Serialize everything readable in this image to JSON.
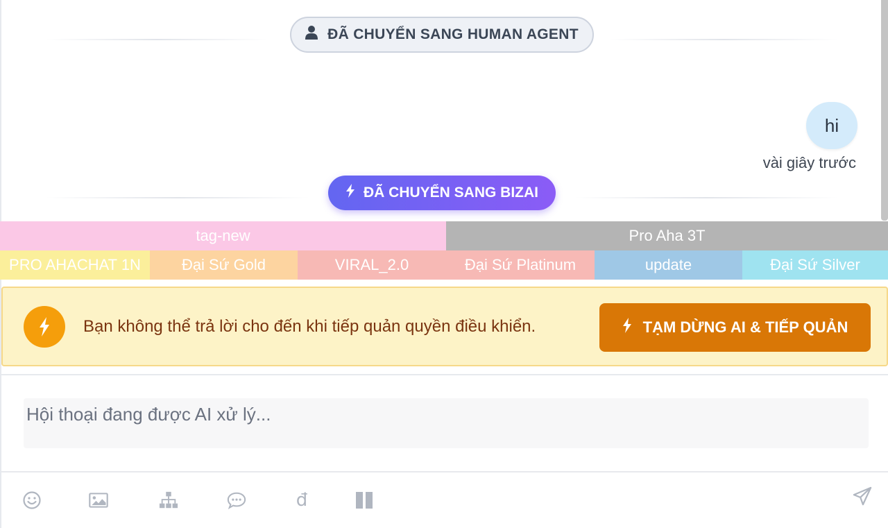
{
  "chat": {
    "status_human": "ĐÃ CHUYỂN SANG HUMAN AGENT",
    "message_text": "hi",
    "message_time": "vài giây trước",
    "status_bizai": "ĐÃ CHUYỂN SANG BIZAI"
  },
  "tags": {
    "row1": [
      {
        "label": "tag-new",
        "color": "#fbc8e6"
      },
      {
        "label": "Pro Aha 3T",
        "color": "#b4b4b4"
      }
    ],
    "row2": [
      {
        "label": "PRO AHACHAT 1N",
        "color": "#fbef9b"
      },
      {
        "label": "Đại Sứ Gold",
        "color": "#fdd4a0"
      },
      {
        "label": "VIRAL_2.0",
        "color": "#f7b9b5"
      },
      {
        "label": "Đại Sứ Platinum",
        "color": "#f7b9b5"
      },
      {
        "label": "update",
        "color": "#9fc8e6"
      },
      {
        "label": "Đại Sứ Silver",
        "color": "#9fe3f0"
      }
    ]
  },
  "warning": {
    "text": "Bạn không thể trả lời cho đến khi tiếp quản quyền điều khiển.",
    "button_label": "TẠM DỪNG AI & TIẾP QUẢN"
  },
  "composer": {
    "placeholder": "Hội thoại đang được AI xử lý...",
    "currency_symbol": "đ"
  },
  "toolbar_icons": [
    "emoji-icon",
    "image-icon",
    "sitemap-icon",
    "chat-bubble-icon",
    "currency-dong-icon",
    "pause-icon",
    "send-icon"
  ],
  "colors": {
    "bizai_gradient_start": "#6366f1",
    "bizai_gradient_end": "#8b5cf6",
    "takeover_button": "#d97706",
    "warning_bg": "#fdf3c7",
    "message_bubble": "#d4ebfb"
  }
}
